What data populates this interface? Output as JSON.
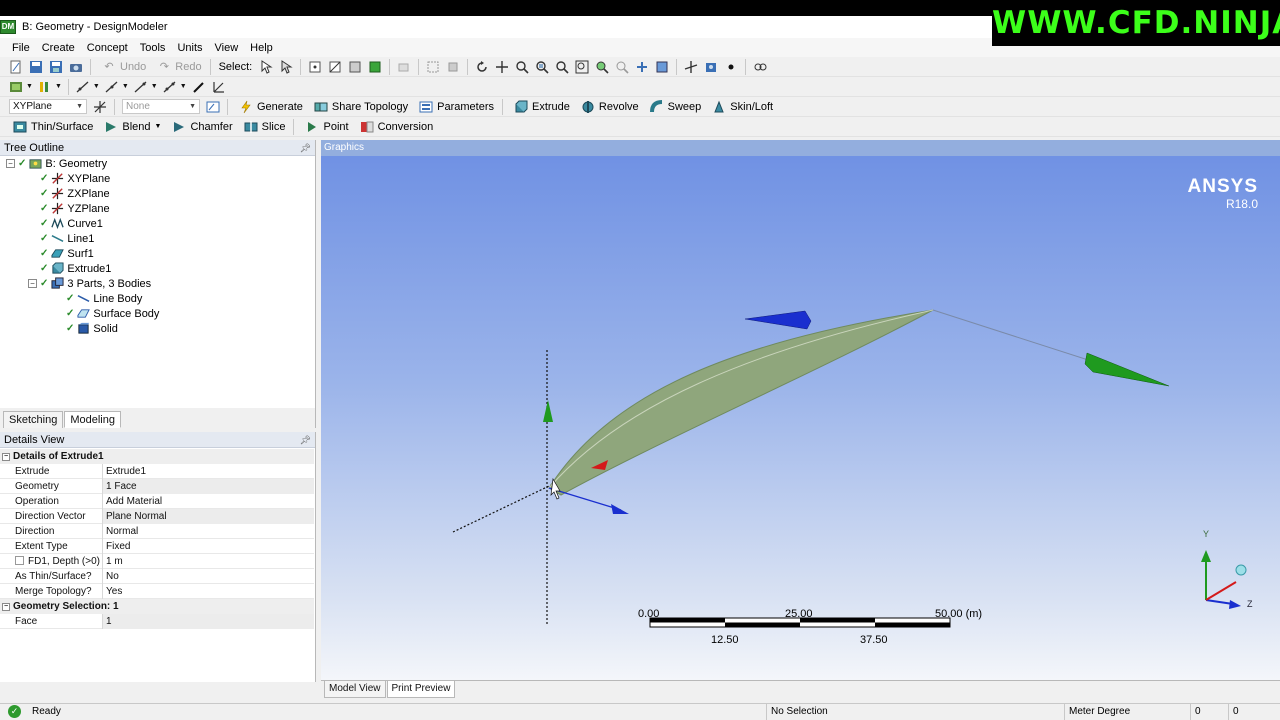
{
  "window": {
    "title": "B: Geometry - DesignModeler",
    "app_icon_text": "DM"
  },
  "brand": "WWW.CFD.NINJA",
  "menu": [
    "File",
    "Create",
    "Concept",
    "Tools",
    "Units",
    "View",
    "Help"
  ],
  "toolbar1": {
    "undo_label": "Undo",
    "redo_label": "Redo",
    "select_label": "Select:"
  },
  "toolbar3": {
    "plane_value": "XYPlane",
    "sketch_value": "None",
    "generate_label": "Generate",
    "share_topology_label": "Share Topology",
    "parameters_label": "Parameters",
    "extrude_label": "Extrude",
    "revolve_label": "Revolve",
    "sweep_label": "Sweep",
    "skin_loft_label": "Skin/Loft"
  },
  "toolbar4": {
    "thin_surface_label": "Thin/Surface",
    "blend_label": "Blend",
    "chamfer_label": "Chamfer",
    "slice_label": "Slice",
    "point_label": "Point",
    "conversion_label": "Conversion"
  },
  "tree": {
    "header": "Tree Outline",
    "root": "B: Geometry",
    "items": [
      "XYPlane",
      "ZXPlane",
      "YZPlane",
      "Curve1",
      "Line1",
      "Surf1",
      "Extrude1"
    ],
    "parts": "3 Parts, 3 Bodies",
    "bodies": [
      "Line Body",
      "Surface Body",
      "Solid"
    ]
  },
  "mode_tabs": {
    "sketching": "Sketching",
    "modeling": "Modeling"
  },
  "details": {
    "header": "Details View",
    "group1": "Details of Extrude1",
    "rows": [
      {
        "k": "Extrude",
        "v": "Extrude1"
      },
      {
        "k": "Geometry",
        "v": "1 Face"
      },
      {
        "k": "Operation",
        "v": "Add Material"
      },
      {
        "k": "Direction Vector",
        "v": "Plane Normal"
      },
      {
        "k": "Direction",
        "v": "Normal"
      },
      {
        "k": "Extent Type",
        "v": "Fixed"
      },
      {
        "k": "FD1,  Depth (>0)",
        "v": "1 m"
      },
      {
        "k": "As Thin/Surface?",
        "v": "No"
      },
      {
        "k": "Merge Topology?",
        "v": "Yes"
      }
    ],
    "group2": "Geometry Selection: 1",
    "face_row": {
      "k": "Face",
      "v": "1"
    }
  },
  "graphics": {
    "header": "Graphics",
    "logo_name": "ANSYS",
    "logo_version": "R18.0",
    "scale": {
      "top_labels": [
        "0.00",
        "25.00",
        "50.00 (m)"
      ],
      "bottom_labels": [
        "12.50",
        "37.50"
      ]
    },
    "triad": {
      "y": "Y",
      "z": "Z"
    }
  },
  "bottom_tabs": {
    "model_view": "Model View",
    "print_preview": "Print Preview"
  },
  "status": {
    "state": "Ready",
    "selection": "No Selection",
    "units": "Meter  Degree",
    "v1": "0",
    "v2": "0"
  },
  "colors": {
    "accent": "#3cff1a",
    "graphics_top": "#6d8fe3",
    "graphics_bottom": "#f4f6fa",
    "body_fill": "#8fa67c"
  }
}
